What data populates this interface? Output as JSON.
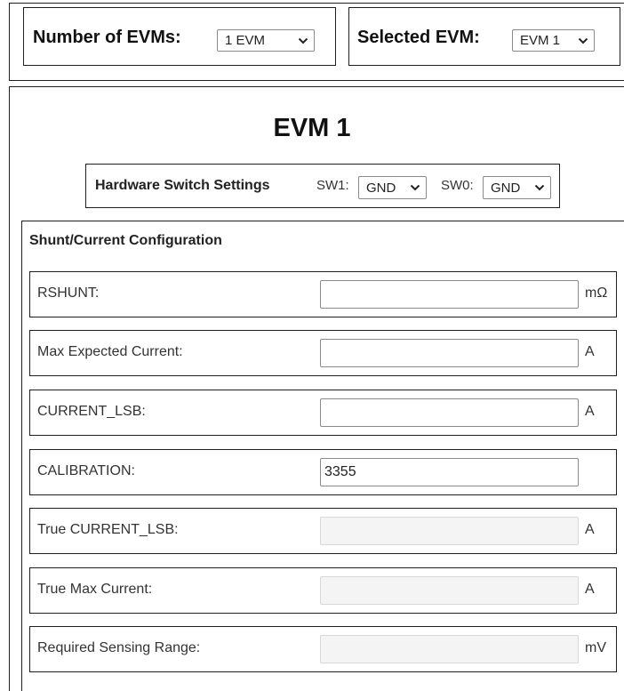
{
  "top": {
    "num_evms_label": "Number of EVMs:",
    "num_evms_value": "1 EVM",
    "selected_evm_label": "Selected EVM:",
    "selected_evm_value": "EVM 1"
  },
  "evm": {
    "title": "EVM 1",
    "hw": {
      "label": "Hardware Switch Settings",
      "sw1_label": "SW1:",
      "sw1_value": "GND",
      "sw0_label": "SW0:",
      "sw0_value": "GND"
    },
    "shunt": {
      "title": "Shunt/Current Configuration",
      "rows": [
        {
          "label": "RSHUNT:",
          "value": "",
          "unit": "mΩ",
          "disabled": false
        },
        {
          "label": "Max Expected Current:",
          "value": "",
          "unit": "A",
          "disabled": false
        },
        {
          "label": "CURRENT_LSB:",
          "value": "",
          "unit": "A",
          "disabled": false
        },
        {
          "label": "CALIBRATION:",
          "value": "3355",
          "unit": "",
          "disabled": false
        },
        {
          "label": "True CURRENT_LSB:",
          "value": "",
          "unit": "A",
          "disabled": true
        },
        {
          "label": "True Max Current:",
          "value": "",
          "unit": "A",
          "disabled": true
        },
        {
          "label": "Required Sensing Range:",
          "value": "",
          "unit": "mV",
          "disabled": true
        }
      ]
    }
  }
}
